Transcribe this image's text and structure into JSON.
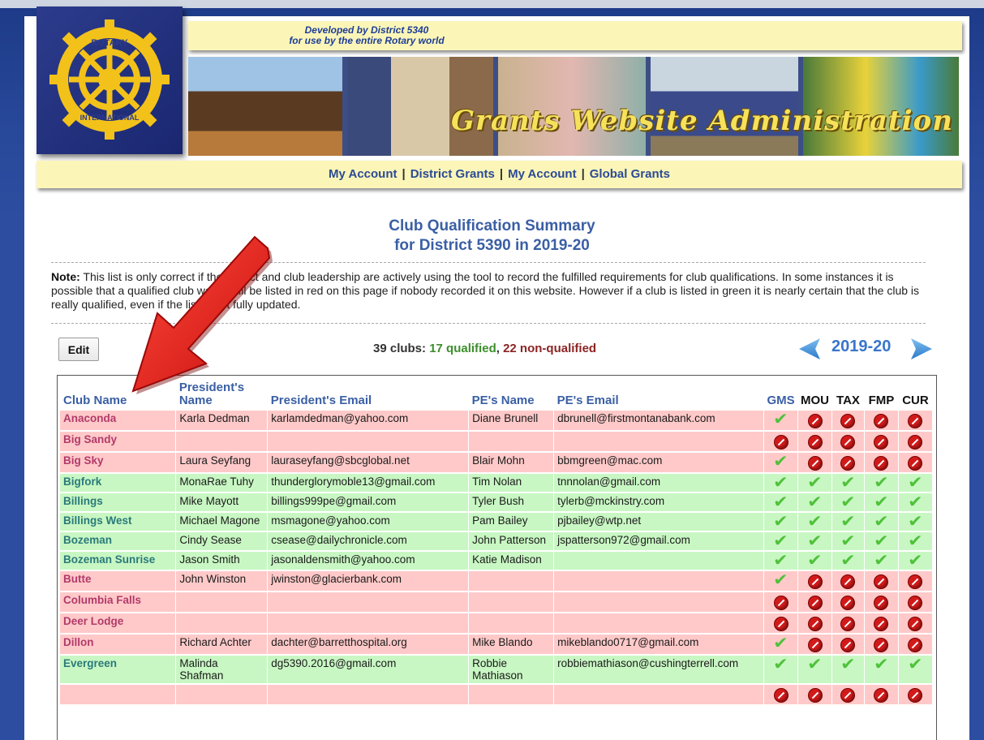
{
  "header": {
    "logo_text_top": "ROTARY",
    "logo_text_bottom": "INTERNATIONAL",
    "developed_line1": "Developed by District 5340",
    "developed_line2": "for use by the entire Rotary world",
    "banner_title": "Grants Website Administration",
    "nav": [
      "My Account",
      "District Grants",
      "My Account",
      "Global Grants"
    ]
  },
  "page": {
    "title_line1": "Club Qualification Summary",
    "title_line2": "for District 5390 in 2019-20",
    "note_label": "Note:",
    "note_text": " This list is only correct if the district and club leadership are actively using the tool to record the fulfilled requirements for club qualifications. In some instances it is possible that a qualified club would still be listed in red on this page if nobody recorded it on this website. However if a club is listed in green it is nearly certain that the club is really qualified, even if the list is not fully updated.",
    "edit_label": "Edit",
    "summary_prefix": "39 clubs: ",
    "summary_ok": "17 qualified",
    "summary_sep": ", ",
    "summary_bad": "22 non-qualified",
    "year": "2019-20"
  },
  "table": {
    "headers": {
      "club": "Club Name",
      "president_line1": "President's",
      "president_line2": "Name",
      "pres_email": "President's Email",
      "pe_name": "PE's Name",
      "pe_email": "PE's Email",
      "gms": "GMS",
      "mou": "MOU",
      "tax": "TAX",
      "fmp": "FMP",
      "cur": "CUR"
    },
    "rows": [
      {
        "status": "red",
        "club": "Anaconda",
        "president": "Karla Dedman",
        "pres_email": "karlamdedman@yahoo.com",
        "pe_name": "Diane Brunell",
        "pe_email": "dbrunell@firstmontanabank.com",
        "flags": [
          true,
          false,
          false,
          false,
          false
        ]
      },
      {
        "status": "red",
        "club": "Big Sandy",
        "president": "",
        "pres_email": "",
        "pe_name": "",
        "pe_email": "",
        "flags": [
          false,
          false,
          false,
          false,
          false
        ]
      },
      {
        "status": "red",
        "club": "Big Sky",
        "president": "Laura Seyfang",
        "pres_email": "lauraseyfang@sbcglobal.net",
        "pe_name": "Blair Mohn",
        "pe_email": "bbmgreen@mac.com",
        "flags": [
          true,
          false,
          false,
          false,
          false
        ]
      },
      {
        "status": "green",
        "club": "Bigfork",
        "president": "MonaRae Tuhy",
        "pres_email": "thunderglorymoble13@gmail.com",
        "pe_name": "Tim Nolan",
        "pe_email": "tnnnolan@gmail.com",
        "flags": [
          true,
          true,
          true,
          true,
          true
        ]
      },
      {
        "status": "green",
        "club": "Billings",
        "president": "Mike Mayott",
        "pres_email": "billings999pe@gmail.com",
        "pe_name": "Tyler Bush",
        "pe_email": "tylerb@mckinstry.com",
        "flags": [
          true,
          true,
          true,
          true,
          true
        ]
      },
      {
        "status": "green",
        "club": "Billings West",
        "president": "Michael Magone",
        "pres_email": "msmagone@yahoo.com",
        "pe_name": "Pam Bailey",
        "pe_email": "pjbailey@wtp.net",
        "flags": [
          true,
          true,
          true,
          true,
          true
        ]
      },
      {
        "status": "green",
        "club": "Bozeman",
        "president": "Cindy Sease",
        "pres_email": "csease@dailychronicle.com",
        "pe_name": "John Patterson",
        "pe_email": "jspatterson972@gmail.com",
        "flags": [
          true,
          true,
          true,
          true,
          true
        ]
      },
      {
        "status": "green",
        "club": "Bozeman Sunrise",
        "president": "Jason Smith",
        "pres_email": "jasonaldensmith@yahoo.com",
        "pe_name": "Katie Madison",
        "pe_email": "",
        "flags": [
          true,
          true,
          true,
          true,
          true
        ]
      },
      {
        "status": "red",
        "club": "Butte",
        "president": "John Winston",
        "pres_email": "jwinston@glacierbank.com",
        "pe_name": "",
        "pe_email": "",
        "flags": [
          true,
          false,
          false,
          false,
          false
        ]
      },
      {
        "status": "red",
        "club": "Columbia Falls",
        "president": "",
        "pres_email": "",
        "pe_name": "",
        "pe_email": "",
        "flags": [
          false,
          false,
          false,
          false,
          false
        ]
      },
      {
        "status": "red",
        "club": "Deer Lodge",
        "president": "",
        "pres_email": "",
        "pe_name": "",
        "pe_email": "",
        "flags": [
          false,
          false,
          false,
          false,
          false
        ]
      },
      {
        "status": "red",
        "club": "Dillon",
        "president": "Richard Achter",
        "pres_email": "dachter@barretthospital.org",
        "pe_name": "Mike Blando",
        "pe_email": "mikeblando0717@gmail.com",
        "flags": [
          true,
          false,
          false,
          false,
          false
        ]
      },
      {
        "status": "green",
        "club": "Evergreen",
        "president": "Malinda Shafman",
        "pres_email": "dg5390.2016@gmail.com",
        "pe_name": "Robbie Mathiason",
        "pe_email": "robbiemathiason@cushingterrell.com",
        "flags": [
          true,
          true,
          true,
          true,
          true
        ]
      },
      {
        "status": "red",
        "club": "",
        "president": "",
        "pres_email": "",
        "pe_name": "",
        "pe_email": "",
        "flags": [
          false,
          false,
          false,
          false,
          false
        ]
      }
    ]
  },
  "colors": {
    "qualified_row": "#c8f7c3",
    "non_qualified_row": "#ffc9c9",
    "header_blue": "#3a5fa4",
    "strip_yellow": "#fbf6b8"
  }
}
